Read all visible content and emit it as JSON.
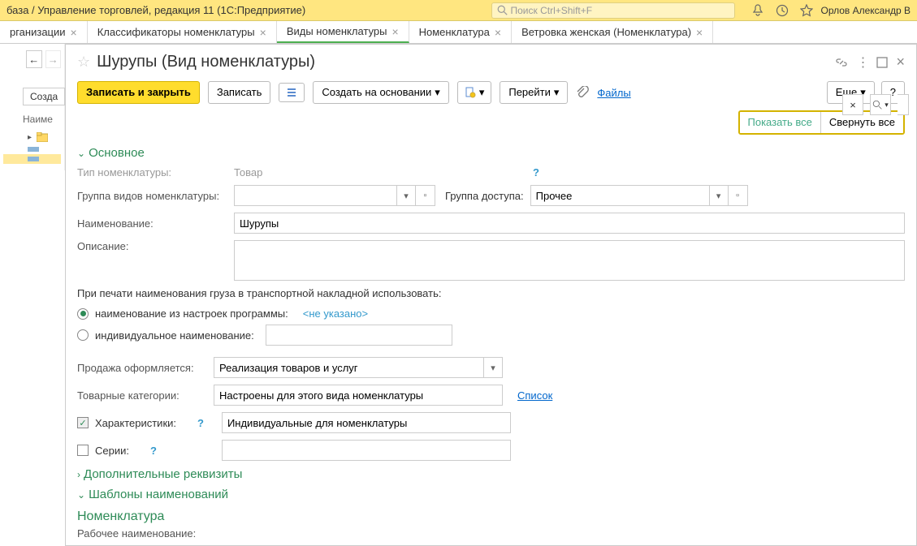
{
  "topbar": {
    "title": "база / Управление торговлей, редакция 11  (1С:Предприятие)",
    "search_placeholder": "Поиск Ctrl+Shift+F",
    "user": "Орлов Александр В"
  },
  "tabs": [
    {
      "label": "рганизации",
      "active": false
    },
    {
      "label": "Классификаторы номенклатуры",
      "active": false
    },
    {
      "label": "Виды номенклатуры",
      "active": true
    },
    {
      "label": "Номенклатура",
      "active": false
    },
    {
      "label": "Ветровка женская (Номенклатура)",
      "active": false
    }
  ],
  "left": {
    "create": "Созда",
    "head": "Наиме"
  },
  "win": {
    "title": "Шурупы (Вид номенклатуры)"
  },
  "toolbar": {
    "save_close": "Записать и закрыть",
    "save": "Записать",
    "create_based": "Создать на основании",
    "go": "Перейти",
    "files": "Файлы",
    "more": "Еще",
    "help": "?"
  },
  "subbar": {
    "show_all": "Показать все",
    "collapse_all": "Свернуть все"
  },
  "main": {
    "section_main": "Основное",
    "type_label": "Тип номенклатуры:",
    "type_value": "Товар",
    "group_label": "Группа видов номенклатуры:",
    "access_group_label": "Группа доступа:",
    "access_group_value": "Прочее",
    "name_label": "Наименование:",
    "name_value": "Шурупы",
    "desc_label": "Описание:",
    "print_note": "При печати наименования груза в транспортной накладной использовать:",
    "radio1": "наименование из настроек программы:",
    "radio1_val": "<не указано>",
    "radio2": "индивидуальное наименование:",
    "sale_label": "Продажа оформляется:",
    "sale_value": "Реализация товаров и услуг",
    "cat_label": "Товарные категории:",
    "cat_value": "Настроены для этого вида номенклатуры",
    "cat_link": "Список",
    "char_label": "Характеристики:",
    "char_value": "Индивидуальные для номенклатуры",
    "series_label": "Серии:",
    "section_add": "Дополнительные реквизиты",
    "section_tpl": "Шаблоны наименований",
    "section_nom": "Номенклатура",
    "work_name": "Рабочее наименование:"
  }
}
